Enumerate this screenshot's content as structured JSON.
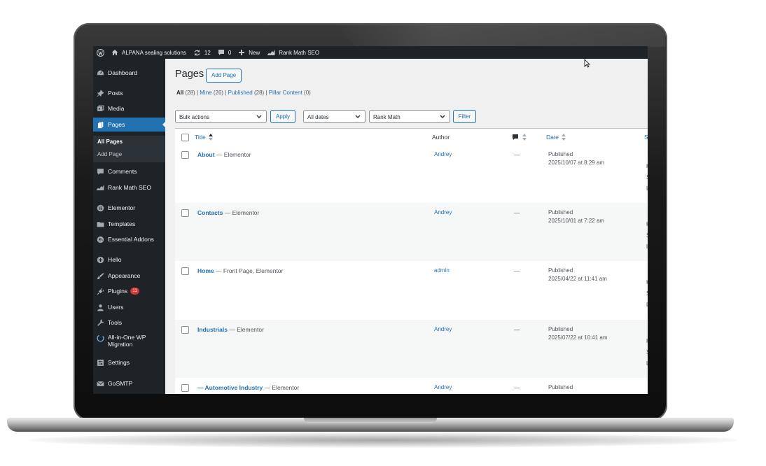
{
  "adminbar": {
    "site_name": "ALPANA sealing solutions",
    "updates_count": "12",
    "comments_count": "0",
    "new_label": "New",
    "rankmath_label": "Rank Math SEO"
  },
  "sidebar": {
    "items": [
      {
        "label": "Dashboard",
        "icon": "dashboard-icon"
      },
      {
        "label": "Posts",
        "icon": "pin-icon"
      },
      {
        "label": "Media",
        "icon": "media-icon"
      },
      {
        "label": "Pages",
        "icon": "pages-icon"
      },
      {
        "label": "Comments",
        "icon": "comment-icon"
      },
      {
        "label": "Rank Math SEO",
        "icon": "rankmath-icon"
      },
      {
        "label": "Elementor",
        "icon": "elementor-icon"
      },
      {
        "label": "Templates",
        "icon": "folder-icon"
      },
      {
        "label": "Essential Addons",
        "icon": "essential-addons-icon"
      },
      {
        "label": "Hello",
        "icon": "plus-circle-icon"
      },
      {
        "label": "Appearance",
        "icon": "brush-icon"
      },
      {
        "label": "Plugins",
        "icon": "plug-icon",
        "badge": "11"
      },
      {
        "label": "Users",
        "icon": "user-icon"
      },
      {
        "label": "Tools",
        "icon": "wrench-icon"
      },
      {
        "label": "All-in-One WP",
        "label2": "Migration",
        "icon": "migration-icon"
      },
      {
        "label": "Settings",
        "icon": "settings-icon"
      },
      {
        "label": "GoSMTP",
        "icon": "mail-icon"
      }
    ],
    "submenu": {
      "all_pages": "All Pages",
      "add_page": "Add Page"
    }
  },
  "main": {
    "title": "Pages",
    "add_button": "Add Page",
    "filters": {
      "all": "All",
      "all_count": "(28)",
      "mine": "Mine",
      "mine_count": "(26)",
      "published": "Published",
      "published_count": "(28)",
      "pillar": "Pillar Content",
      "pillar_count": "(0)",
      "sep": "|"
    },
    "bulk_actions": "Bulk actions",
    "apply": "Apply",
    "dates": "All dates",
    "rankmath": "Rank Math",
    "filter": "Filter",
    "columns": {
      "title": "Title",
      "author": "Author",
      "date": "Date",
      "cut": "S"
    },
    "rows": [
      {
        "title": "About",
        "suffix": " — Elementor",
        "author": "Andrey",
        "comments": "—",
        "status": "Published",
        "date": "2025/10/07 at 8:29 am"
      },
      {
        "title": "Contacts",
        "suffix": " — Elementor",
        "author": "Andrey",
        "comments": "—",
        "status": "Published",
        "date": "2025/10/01 at 7:22 am"
      },
      {
        "title": "Home",
        "suffix": " — Front Page, Elementor",
        "author": "admin",
        "comments": "—",
        "status": "Published",
        "date": "2025/04/22 at 11:41 am"
      },
      {
        "title": "Industrials",
        "suffix": " — Elementor",
        "author": "Andrey",
        "comments": "—",
        "status": "Published",
        "date": "2025/07/22 at 10:41 am"
      },
      {
        "title": "— Automotive Industry",
        "suffix": " — Elementor",
        "author": "Andrey",
        "comments": "—",
        "status": "Published",
        "date": ""
      }
    ],
    "cut_letters": [
      "K",
      "S",
      "L"
    ]
  },
  "colors": {
    "accent": "#2271b1",
    "sidebar_bg": "#1d2327",
    "badge": "#d63638"
  }
}
